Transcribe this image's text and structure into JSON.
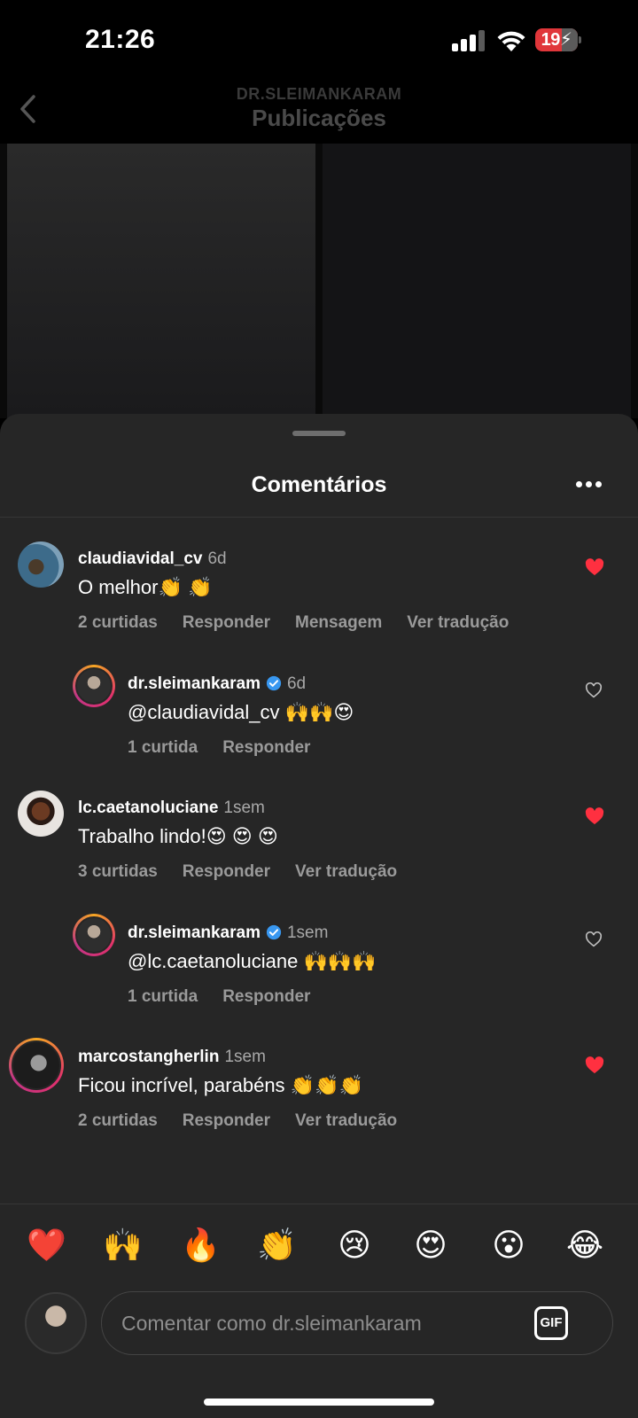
{
  "status": {
    "time": "21:26",
    "battery": "19"
  },
  "header": {
    "account": "DR.SLEIMANKARAM",
    "title": "Publicações"
  },
  "sheet": {
    "title": "Comentários"
  },
  "comments": [
    {
      "user": "claudiavidal_cv",
      "time": "6d",
      "text": "O melhor👏 👏",
      "likes": "2 curtidas",
      "reply": "Responder",
      "message": "Mensagem",
      "translate": "Ver tradução",
      "liked": true,
      "verified": false
    },
    {
      "user": "dr.sleimankaram",
      "time": "6d",
      "text": "@claudiavidal_cv 🙌🙌😍",
      "likes": "1 curtida",
      "reply": "Responder",
      "liked": false,
      "verified": true
    },
    {
      "user": "lc.caetanoluciane",
      "time": "1sem",
      "text": "Trabalho lindo!😍 😍 😍",
      "likes": "3 curtidas",
      "reply": "Responder",
      "translate": "Ver tradução",
      "liked": true,
      "verified": false
    },
    {
      "user": "dr.sleimankaram",
      "time": "1sem",
      "text": "@lc.caetanoluciane 🙌🙌🙌",
      "likes": "1 curtida",
      "reply": "Responder",
      "liked": false,
      "verified": true
    },
    {
      "user": "marcostangherlin",
      "time": "1sem",
      "text": "Ficou incrível, parabéns 👏👏👏",
      "likes": "2 curtidas",
      "reply": "Responder",
      "translate": "Ver tradução",
      "liked": true,
      "verified": false
    }
  ],
  "emojis": [
    "❤️",
    "🙌",
    "🔥",
    "👏",
    "😢",
    "😍",
    "😮",
    "😂"
  ],
  "composer": {
    "placeholder": "Comentar como dr.sleimankaram",
    "gif_label": "GIF"
  },
  "colors": {
    "liked": "#ff3040",
    "sheet_bg": "#262626",
    "verified": "#3897f0"
  }
}
